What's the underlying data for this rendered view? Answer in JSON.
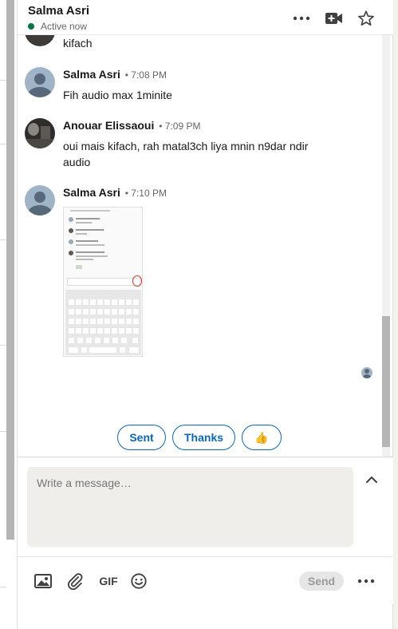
{
  "header": {
    "name": "Salma Asri",
    "status": "Active now",
    "icons": [
      "more-icon",
      "video-call-icon",
      "star-icon"
    ]
  },
  "thread": {
    "partial_message": "kifach",
    "messages": [
      {
        "sender": "Salma Asri",
        "time": "• 7:08 PM",
        "text": "Fih audio max 1minite"
      },
      {
        "sender": "Anouar Elissaoui",
        "time": "• 7:09 PM",
        "text": "oui mais kifach, rah matal3ch liya mnin n9dar ndir audio"
      },
      {
        "sender": "Salma Asri",
        "time": "• 7:10 PM",
        "text": ""
      }
    ]
  },
  "quick_replies": [
    "Sent",
    "Thanks",
    "👍"
  ],
  "compose": {
    "placeholder": "Write a message…"
  },
  "toolbar": {
    "gif_label": "GIF",
    "send_label": "Send"
  },
  "colors": {
    "accent": "#0a66c2",
    "status_green": "#057642",
    "compose_bg": "#f0eeea"
  }
}
